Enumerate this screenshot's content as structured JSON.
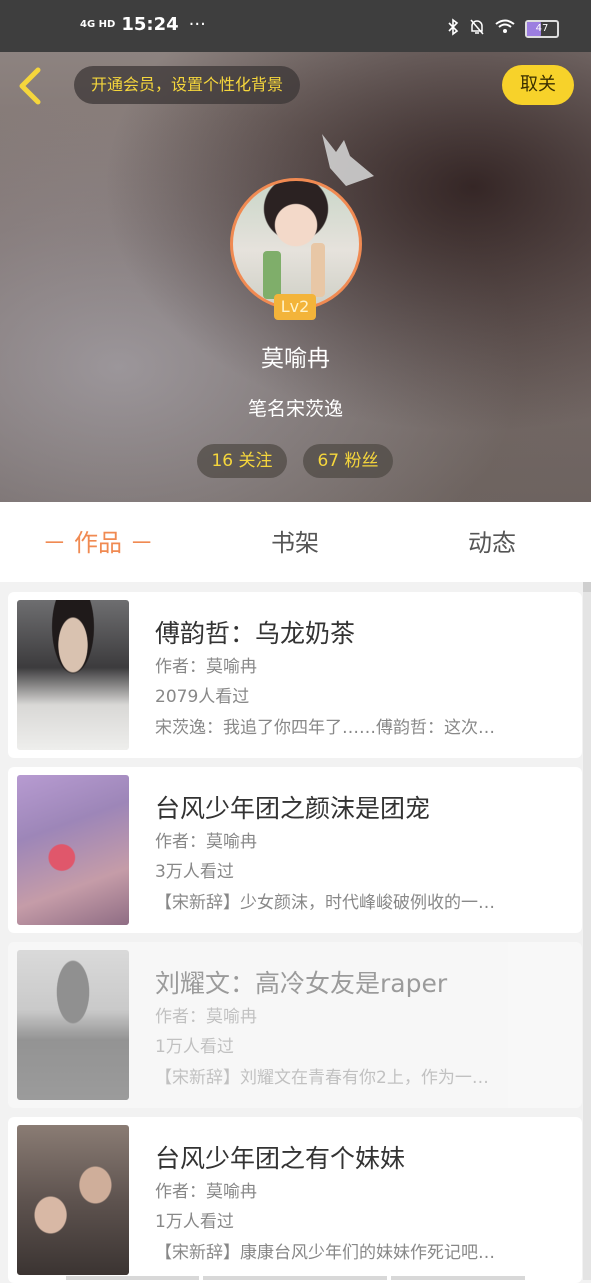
{
  "status_bar": {
    "network": "4G HD",
    "time": "15:24",
    "more": "···",
    "battery": "47",
    "battery_level": 0.47
  },
  "header": {
    "promo_text": "开通会员，设置个性化背景",
    "close_label": "取关",
    "level": "Lv2",
    "username": "莫喻冉",
    "pen_name": "笔名宋茨逸",
    "following": "16 关注",
    "fans": "67 粉丝"
  },
  "tabs": [
    {
      "label": "－ 作品 －",
      "active": true
    },
    {
      "label": "书架",
      "active": false
    },
    {
      "label": "动态",
      "active": false
    }
  ],
  "books": [
    {
      "title": "傅韵哲：乌龙奶茶",
      "author": "作者：莫喻冉",
      "views": "2079人看过",
      "summary": "宋茨逸：我追了你四年了……傅韵哲：这次…",
      "cover_caption": ""
    },
    {
      "title": "台风少年团之颜沫是团宠",
      "author": "作者：莫喻冉",
      "views": "3万人看过",
      "summary": "【宋新辞】少女颜沫，时代峰峻破例收的一…",
      "cover_caption": ""
    },
    {
      "title": "刘耀文：高冷女友是raper",
      "author": "作者：莫喻冉",
      "views": "1万人看过",
      "summary": "【宋新辞】刘耀文在青春有你2上，作为一…",
      "cover_caption": ""
    },
    {
      "title": "台风少年团之有个妹妹",
      "author": "作者：莫喻冉",
      "views": "1万人看过",
      "summary": "【宋新辞】康康台风少年们的妹妹作死记吧…",
      "cover_caption": ""
    }
  ]
}
